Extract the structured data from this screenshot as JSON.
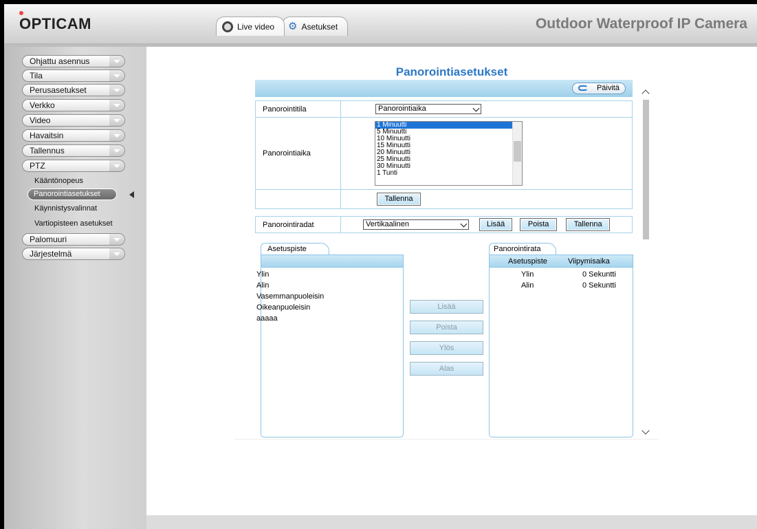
{
  "header": {
    "logo": "OPTICAM",
    "tabs": [
      {
        "label": "Live video"
      },
      {
        "label": "Asetukset"
      }
    ],
    "product_title": "Outdoor Waterproof IP Camera"
  },
  "sidebar": {
    "items": [
      {
        "label": "Ohjattu asennus"
      },
      {
        "label": "Tila"
      },
      {
        "label": "Perusasetukset"
      },
      {
        "label": "Verkko"
      },
      {
        "label": "Video"
      },
      {
        "label": "Havaitsin"
      },
      {
        "label": "Tallennus"
      },
      {
        "label": "PTZ"
      }
    ],
    "ptz_sub": [
      {
        "label": "Kääntönopeus"
      },
      {
        "label": "Panorointiasetukset"
      },
      {
        "label": "Käynnistysvalinnat"
      },
      {
        "label": "Vartiopisteen asetukset"
      }
    ],
    "after_items": [
      {
        "label": "Palomuuri"
      },
      {
        "label": "Järjestelmä"
      }
    ]
  },
  "main": {
    "title": "Panorointiasetukset",
    "refresh_label": "Päivitä",
    "mode_label": "Panorointitila",
    "mode_value": "Panorointiaika",
    "time_label": "Panorointiaika",
    "time_options": [
      "1 Minuutti",
      "5 Minuutti",
      "10 Minuutti",
      "15 Minuutti",
      "20 Minuutti",
      "25 Minuutti",
      "30 Minuutti",
      "1 Tunti"
    ],
    "save_label": "Tallenna",
    "tracks_label": "Panorointiradat",
    "track_value": "Vertikaalinen",
    "add_label": "Lisää",
    "delete_label": "Poista",
    "save2_label": "Tallenna",
    "presets_tab": "Asetuspiste",
    "presets": [
      "Ylin",
      "Alin",
      "Vasemmanpuoleisin",
      "Oikeanpuoleisin",
      "aaaaa"
    ],
    "cmd": {
      "add": "Lisää",
      "delete": "Poista",
      "up": "Ylös",
      "down": "Alas"
    },
    "track_tab": "Panorointirata",
    "track_cols": [
      "Asetuspiste",
      "Viipymisaika"
    ],
    "track_rows": [
      {
        "point": "Ylin",
        "delay": "0 Sekuntti"
      },
      {
        "point": "Alin",
        "delay": "0 Sekuntti"
      }
    ]
  }
}
